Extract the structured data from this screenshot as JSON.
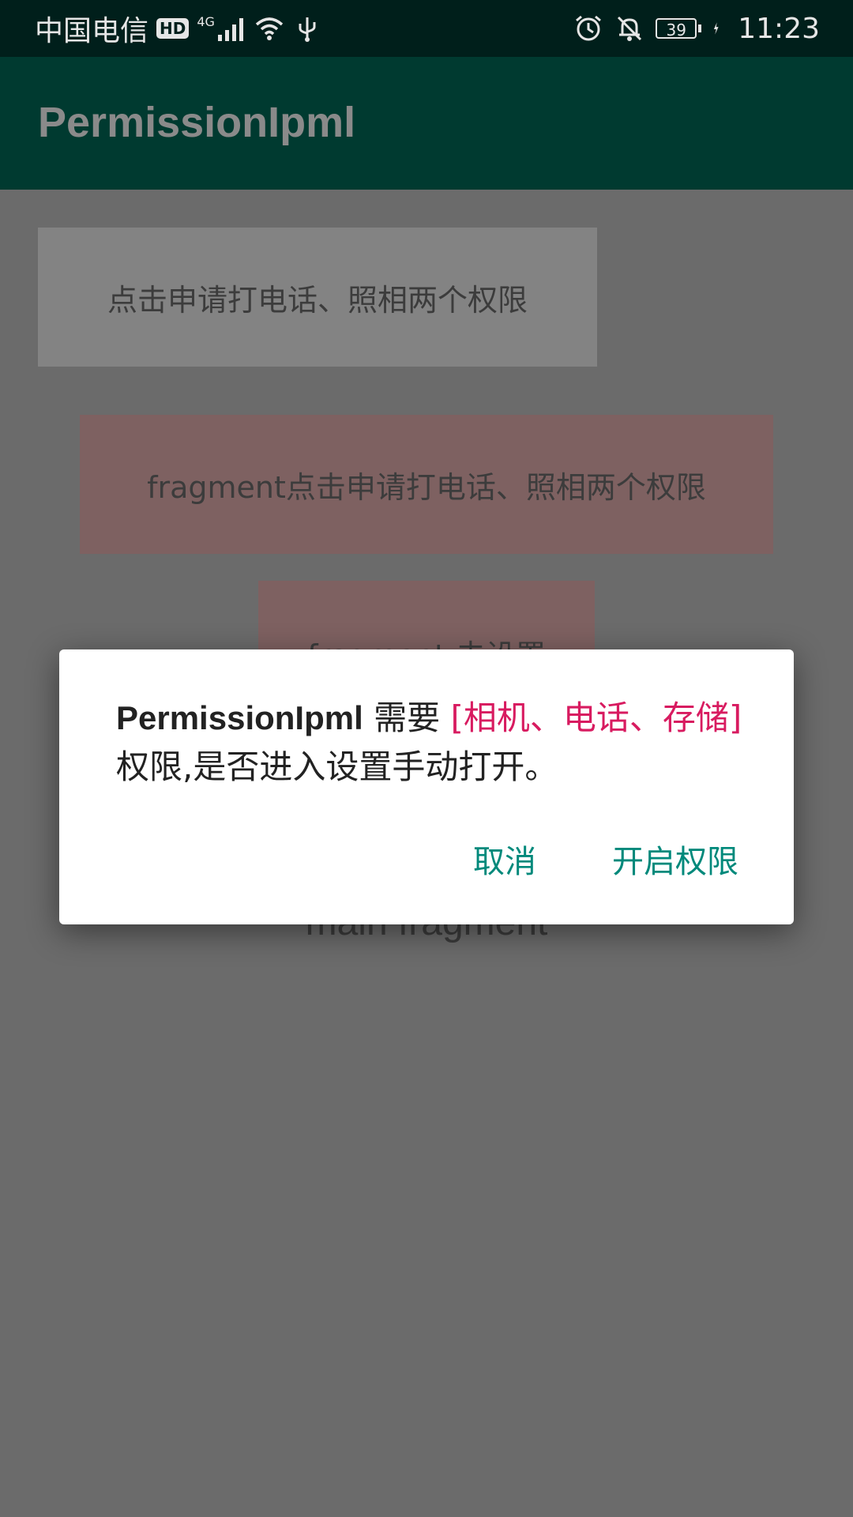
{
  "status_bar": {
    "carrier": "中国电信",
    "hd": "HD",
    "network_gen": "4G",
    "battery_level": "39",
    "time": "11:23",
    "icons": [
      "hd-icon",
      "signal-icon",
      "wifi-icon",
      "usb-icon",
      "alarm-icon",
      "mute-icon",
      "battery-icon",
      "charging-icon"
    ]
  },
  "app_bar": {
    "title": "PermissionIpml"
  },
  "main": {
    "request_button_label": "点击申请打电话、照相两个权限",
    "fragment_request_button_label": "fragment点击申请打电话、照相两个权限",
    "fragment_settings_button_label": "fragment 去设置",
    "main_fragment_label": "main fragment"
  },
  "dialog": {
    "app_name": "PermissionIpml",
    "needs_text": " 需要 ",
    "permission_list": "[相机、电话、存储]",
    "message_suffix": " 权限,是否进入设置手动打开。",
    "cancel_label": "取消",
    "confirm_label": "开启权限"
  },
  "colors": {
    "status_bar_bg": "#001f1b",
    "app_bar_bg": "#003a30",
    "scrim": "#6b6b6b",
    "permission_highlight": "#d81b60",
    "dialog_button": "#00897b"
  }
}
